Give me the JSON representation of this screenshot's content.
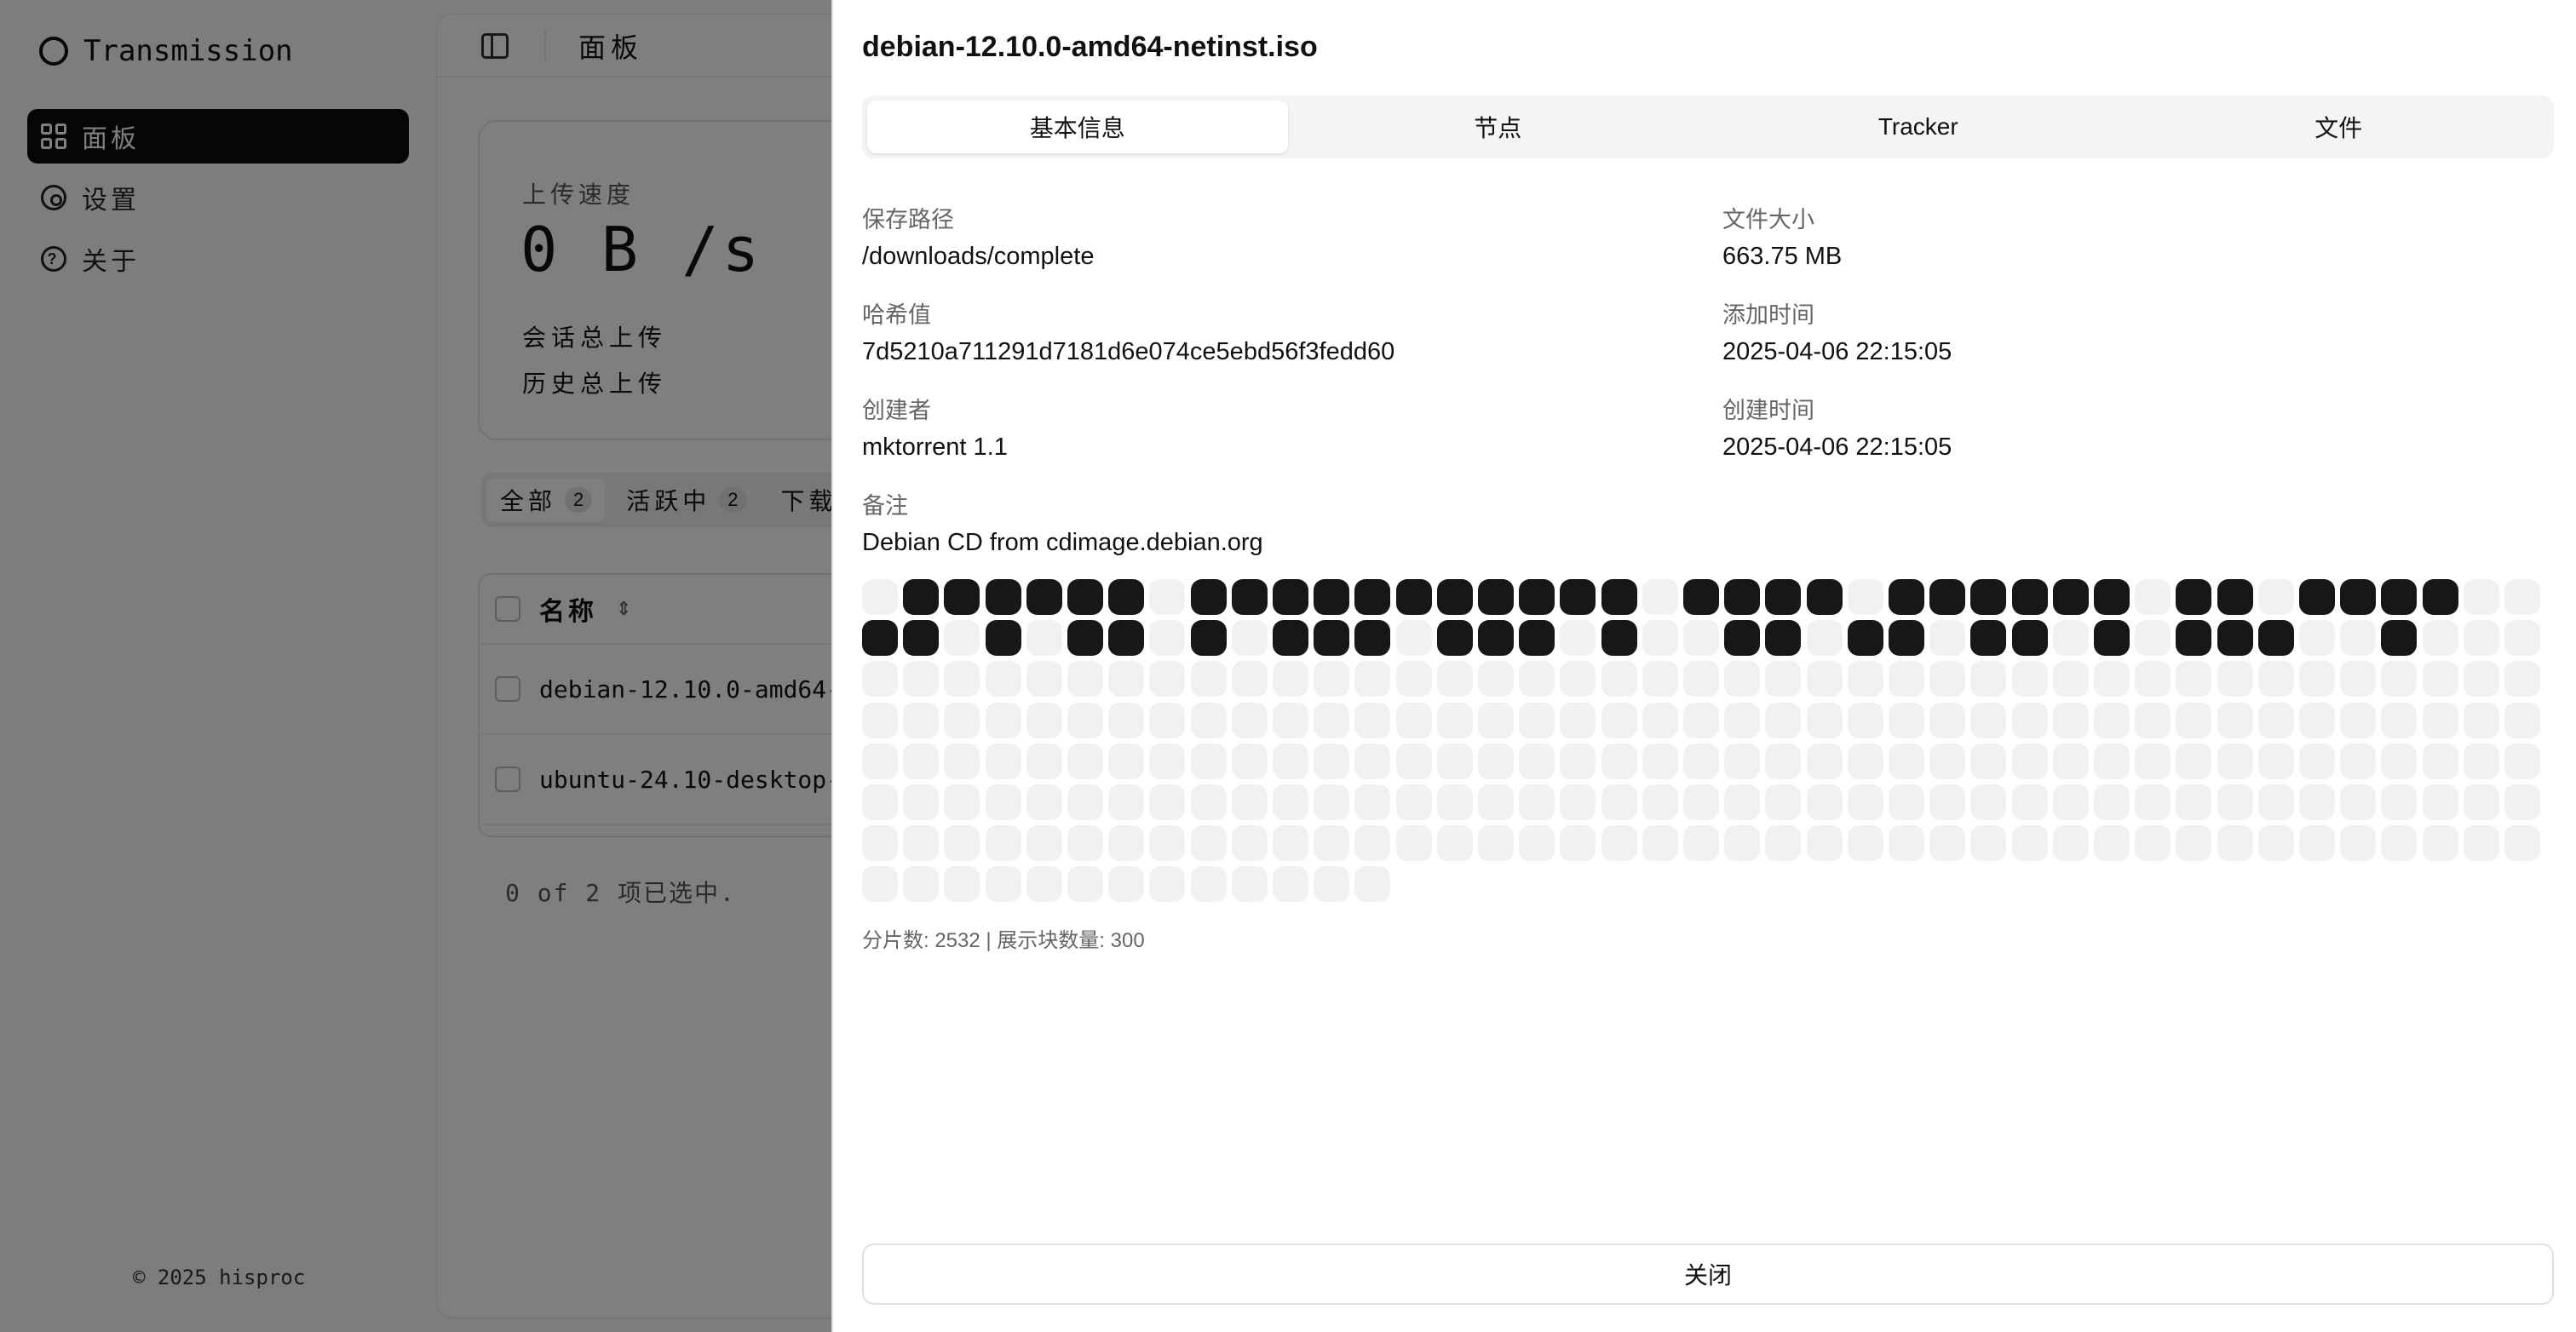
{
  "app": {
    "brand": "Transmission",
    "nav": [
      {
        "label": "面板",
        "icon": "dashboard-icon",
        "active": true
      },
      {
        "label": "设置",
        "icon": "gear-icon",
        "active": false
      },
      {
        "label": "关于",
        "icon": "help-icon",
        "active": false
      }
    ],
    "footer": "© 2025 hisproc",
    "page_title": "面板",
    "upload": {
      "label": "上传速度",
      "value": "0 B /s",
      "session_total_label": "会话总上传",
      "history_total_label": "历史总上传"
    },
    "filters": [
      {
        "label": "全部",
        "count": "2"
      },
      {
        "label": "活跃中",
        "count": "2"
      },
      {
        "label": "下载"
      }
    ],
    "table": {
      "name_header": "名称",
      "rows": [
        "debian-12.10.0-amd64-",
        "ubuntu-24.10-desktop-"
      ]
    },
    "selection_text": "0 of 2 项已选中."
  },
  "drawer": {
    "title": "debian-12.10.0-amd64-netinst.iso",
    "tabs": [
      {
        "label": "基本信息",
        "active": true
      },
      {
        "label": "节点",
        "active": false
      },
      {
        "label": "Tracker",
        "active": false
      },
      {
        "label": "文件",
        "active": false
      }
    ],
    "info": {
      "save_path": {
        "key": "保存路径",
        "value": "/downloads/complete"
      },
      "file_size": {
        "key": "文件大小",
        "value": "663.75 MB"
      },
      "hash": {
        "key": "哈希值",
        "value": "7d5210a711291d7181d6e074ce5ebd56f3fedd60"
      },
      "added_time": {
        "key": "添加时间",
        "value": "2025-04-06 22:15:05"
      },
      "creator": {
        "key": "创建者",
        "value": "mktorrent 1.1"
      },
      "created_time": {
        "key": "创建时间",
        "value": "2025-04-06 22:15:05"
      },
      "comment": {
        "key": "备注",
        "value": "Debian CD from cdimage.debian.org"
      }
    },
    "pieces": {
      "row1": "011111101111111111101111011111101101111",
      "row2": "001101011010111011101001101101101011100",
      "row3": "1",
      "total_blocks": 300,
      "summary": "分片数: 2532 | 展示块数量: 300"
    },
    "close_label": "关闭"
  }
}
